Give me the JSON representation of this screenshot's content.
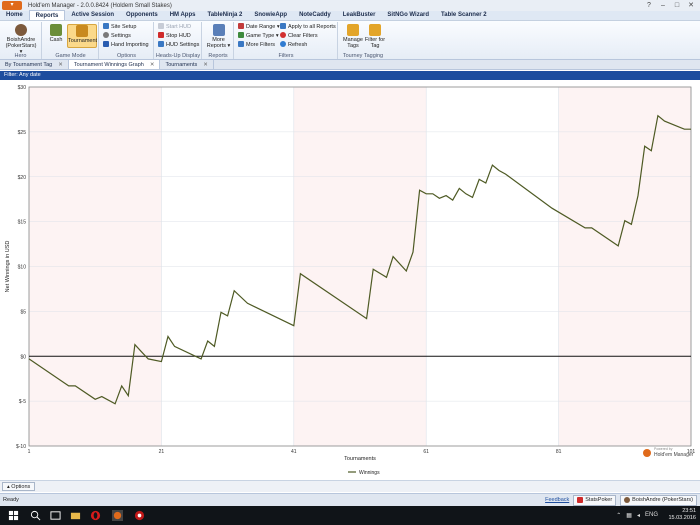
{
  "window": {
    "title": "Hold'em Manager - 2.0.0.8424 (Holdem Small Stakes)",
    "app_button": "▾"
  },
  "menu": [
    "Home",
    "Reports",
    "Active Session",
    "Opponents",
    "HM Apps",
    "TableNinja 2",
    "SnowieApp",
    "NoteCaddy",
    "LeakBuster",
    "SitNGo Wizard",
    "Table Scanner 2"
  ],
  "ribbon": {
    "hero": {
      "label": "BoishAndre (PokerStars) ▾",
      "group": "Hero"
    },
    "game_mode": {
      "cash": "Cash",
      "tournament": "Tournament",
      "group": "Game Mode"
    },
    "options": {
      "site_setup": "Site Setup",
      "settings": "Settings",
      "hand_importing": "Hand Importing",
      "group": "Options"
    },
    "hud": {
      "start": "Start HUD",
      "stop": "Stop HUD",
      "settings": "HUD Settings",
      "group": "Heads-Up Display"
    },
    "reports": {
      "more": "More Reports ▾",
      "group": "Reports"
    },
    "filters": {
      "date_range": "Date Range ▾",
      "game_type": "Game Type ▾",
      "more": "More Filters",
      "apply_all": "Apply to all Reports",
      "clear": "Clear Filters",
      "refresh": "Refresh",
      "group": "Filters"
    },
    "tagging": {
      "manage": "Manage Tags",
      "filter": "Filter for Tag",
      "group": "Tourney Tagging"
    }
  },
  "doc_tabs": [
    "By Tournament Tag",
    "Tournament Winnings Graph",
    "Tournaments"
  ],
  "filter_text": "Filter: Any date",
  "chart_data": {
    "type": "line",
    "xlabel": "Tournaments",
    "ylabel": "Net Winnings in USD",
    "xlim": [
      1,
      101
    ],
    "ylim": [
      -10,
      30
    ],
    "xticks": [
      1,
      21,
      41,
      61,
      81,
      101
    ],
    "yticks": [
      30,
      25,
      20,
      15,
      10,
      5,
      0,
      -5,
      -10
    ],
    "ytick_labels": [
      "$30",
      "$25",
      "$20",
      "$15",
      "$10",
      "$5",
      "$0",
      "$-5",
      "$-10"
    ],
    "shaded_ranges": [
      [
        1,
        21
      ],
      [
        41,
        61
      ],
      [
        81,
        101
      ]
    ],
    "legend": "bottom-center",
    "series": [
      {
        "name": "Winnings",
        "color": "#4e5a24",
        "x": [
          1,
          7,
          8,
          11,
          12,
          14,
          15,
          16,
          17,
          18,
          19,
          21,
          22,
          23,
          27,
          28,
          29,
          30,
          31,
          32,
          34,
          41,
          42,
          52,
          53,
          55,
          56,
          58,
          59,
          60,
          61,
          62,
          63,
          64,
          65,
          66,
          67,
          68,
          69,
          70,
          71,
          72,
          73,
          80,
          85,
          86,
          90,
          91,
          92,
          93,
          94,
          95,
          96,
          97,
          100,
          101
        ],
        "y": [
          -0.3,
          -3.3,
          -3.3,
          -4.8,
          -4.5,
          -5.3,
          -3.3,
          -4.4,
          1.3,
          0.5,
          -0.3,
          -0.6,
          2.2,
          1.1,
          -0.3,
          1.7,
          1.1,
          4.9,
          4.5,
          7.3,
          5.9,
          3.4,
          9.2,
          4.2,
          9.7,
          8.8,
          11.1,
          9.5,
          11.6,
          18.5,
          18.1,
          18.1,
          17.6,
          17.9,
          17.4,
          18.7,
          18.1,
          17.7,
          19.7,
          19.3,
          21.3,
          20.7,
          20.3,
          16.5,
          14.3,
          14.3,
          12.3,
          15.1,
          14.7,
          17.9,
          23.4,
          22.9,
          26.8,
          26.2,
          25.3,
          25.3
        ]
      }
    ]
  },
  "branding": {
    "logo_text": "Hold'em Manager",
    "logo_small": "Powered by"
  },
  "options_label": "Options",
  "status": {
    "ready": "Ready",
    "feedback": "Feedback",
    "stats_poker": "StatsPoker",
    "player": "BoishAndre (PokerStars)"
  },
  "taskbar": {
    "time": "23:51",
    "date": "15.03.2016",
    "lang": "ENG"
  }
}
